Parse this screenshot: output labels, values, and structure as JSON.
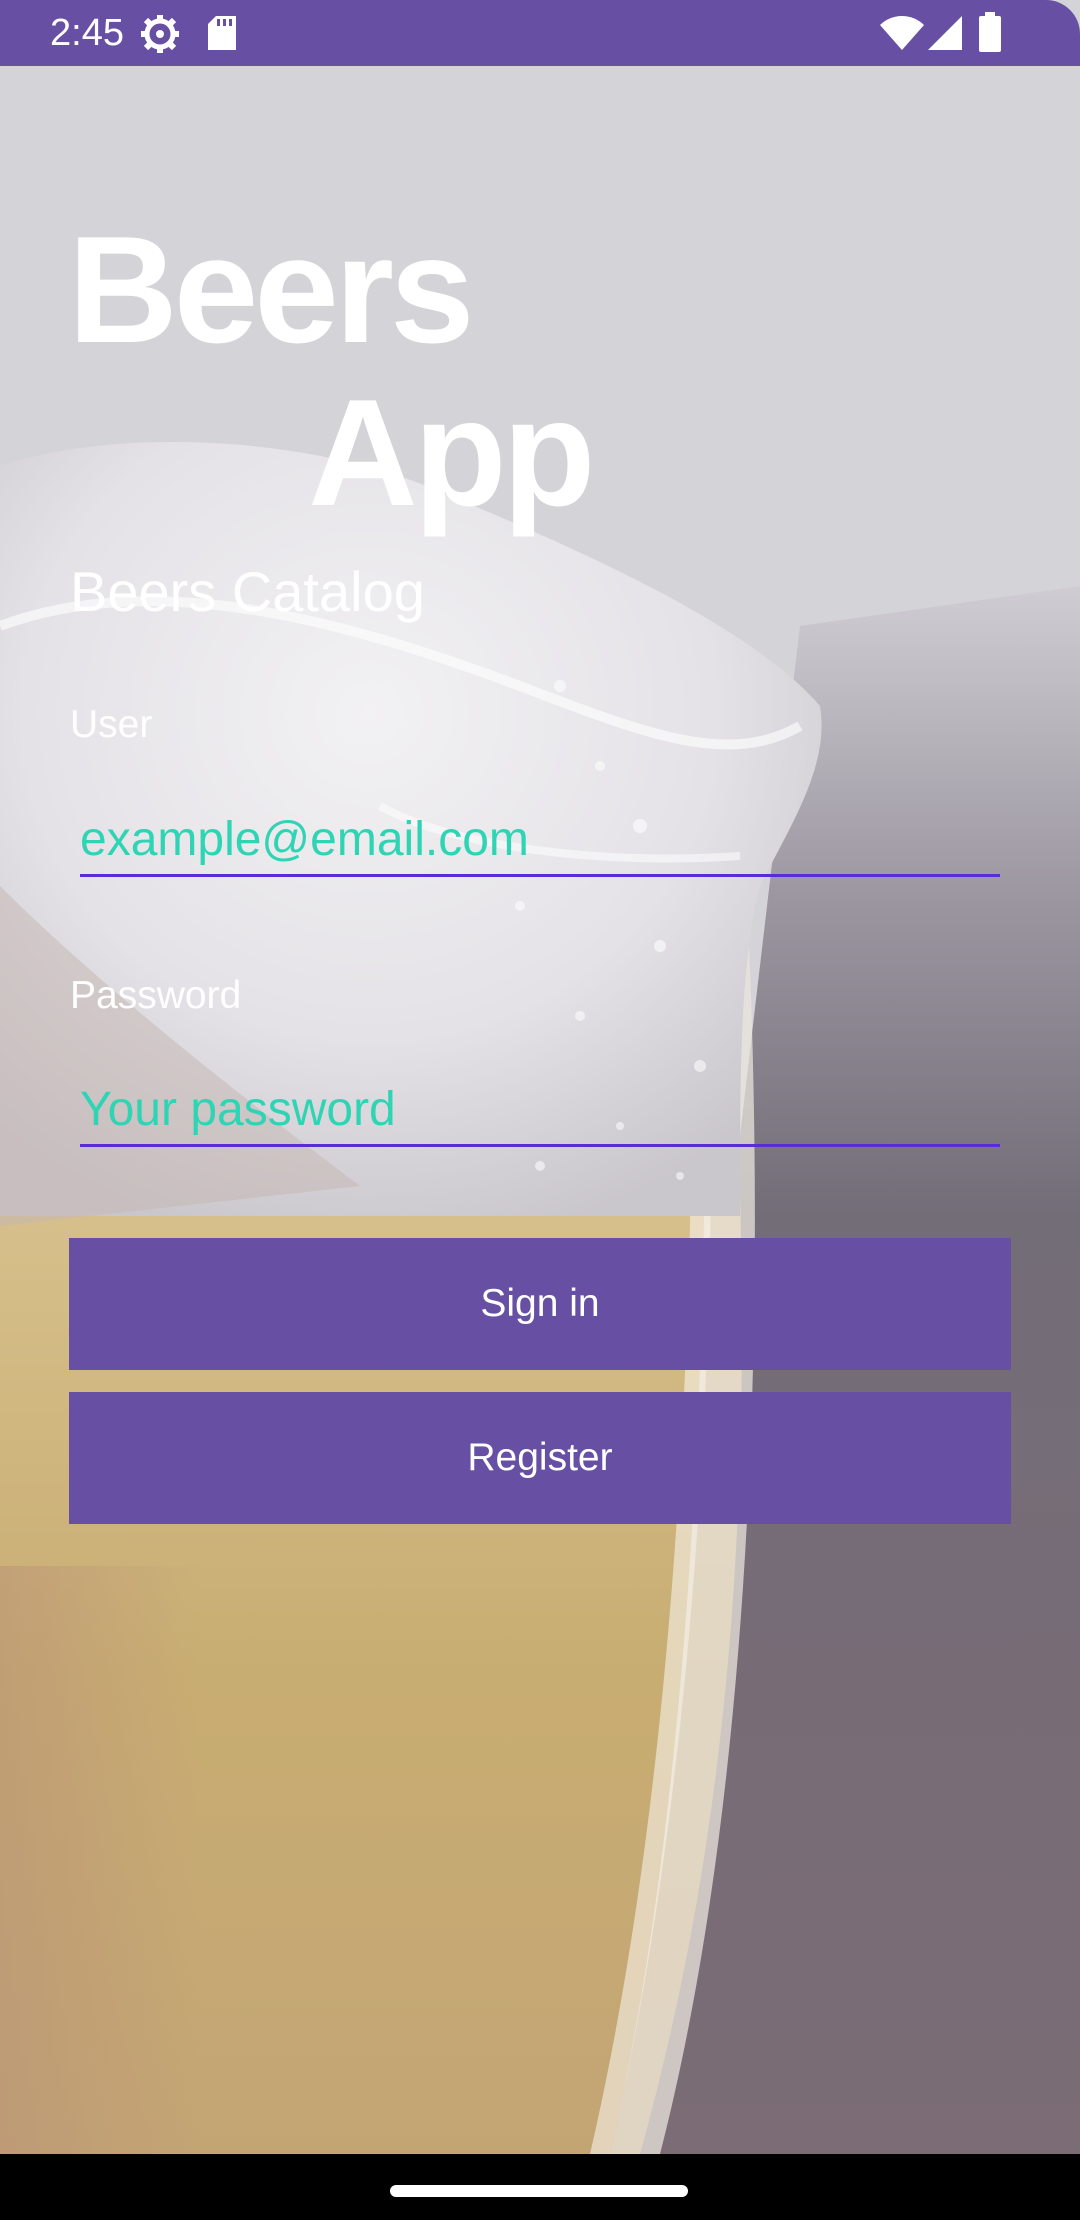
{
  "status_bar": {
    "time": "2:45",
    "icons": [
      "settings-gear-icon",
      "sd-card-icon",
      "wifi-icon",
      "cellular-signal-icon",
      "battery-icon"
    ],
    "background_color": "#6750a4"
  },
  "app": {
    "title_line1": "Beers",
    "title_line2": "App",
    "subtitle": "Beers Catalog"
  },
  "form": {
    "user_label": "User",
    "user_placeholder": "example@email.com",
    "password_label": "Password",
    "password_placeholder": "Your password",
    "signin_label": "Sign in",
    "register_label": "Register"
  },
  "colors": {
    "accent": "#6750a4",
    "input_text": "#2fd4b5",
    "input_underline": "#5b2bd6"
  },
  "background": {
    "image": "beer-glass-photo"
  }
}
